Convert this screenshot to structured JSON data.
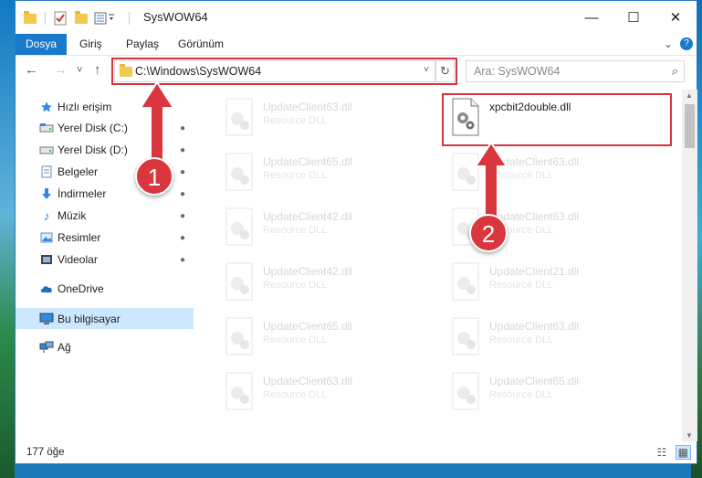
{
  "window": {
    "title": "SysWOW64",
    "minimize": "—",
    "maximize": "☐",
    "close": "✕"
  },
  "ribbon": {
    "tabs": [
      "Dosya",
      "Giriş",
      "Paylaş",
      "Görünüm"
    ],
    "expand": "⌄",
    "help": "?"
  },
  "address": {
    "back": "←",
    "forward": "→",
    "recent": "˅",
    "up": "↑",
    "path": "C:\\Windows\\SysWOW64",
    "dropdown": "˅",
    "refresh": "↻"
  },
  "search": {
    "placeholder": "Ara: SysWOW64",
    "icon": "⌕"
  },
  "sidebar": {
    "items": [
      {
        "label": "Hızlı erişim",
        "icon": "star-icon",
        "pinned": false
      },
      {
        "label": "Yerel Disk (C:)",
        "icon": "drive-icon",
        "pinned": true
      },
      {
        "label": "Yerel Disk (D:)",
        "icon": "drive-icon",
        "pinned": true
      },
      {
        "label": "Belgeler",
        "icon": "document-icon",
        "pinned": true
      },
      {
        "label": "İndirmeler",
        "icon": "download-icon",
        "pinned": true
      },
      {
        "label": "Müzik",
        "icon": "music-icon",
        "pinned": true
      },
      {
        "label": "Resimler",
        "icon": "pictures-icon",
        "pinned": true
      },
      {
        "label": "Videolar",
        "icon": "video-icon",
        "pinned": true
      },
      {
        "label": "OneDrive",
        "icon": "cloud-icon",
        "pinned": false
      },
      {
        "label": "Bu bilgisayar",
        "icon": "computer-icon",
        "pinned": false,
        "selected": true
      },
      {
        "label": "Ağ",
        "icon": "network-icon",
        "pinned": false
      }
    ],
    "pin_glyph": "📌"
  },
  "files": {
    "left_column": [
      {
        "name": "UpdateClient63.dll",
        "type": "Resource DLL"
      },
      {
        "name": "UpdateClient65.dll",
        "type": "Resource DLL"
      },
      {
        "name": "UpdateClient42.dll",
        "type": "Resource DLL"
      },
      {
        "name": "UpdateClient42.dll",
        "type": "Resource DLL"
      },
      {
        "name": "UpdateClient65.dll",
        "type": "Resource DLL"
      },
      {
        "name": "UpdateClient63.dll",
        "type": "Resource DLL"
      }
    ],
    "right_column": [
      {
        "name": "xpcbit2double.dll",
        "type": "",
        "highlighted": true
      },
      {
        "name": "UpdateClient63.dll",
        "type": "Resource DLL"
      },
      {
        "name": "UpdateClient63.dll",
        "type": "Resource DLL"
      },
      {
        "name": "UpdateClient21.dll",
        "type": "Resource DLL"
      },
      {
        "name": "UpdateClient63.dll",
        "type": "Resource DLL"
      },
      {
        "name": "UpdateClient65.dll",
        "type": "Resource DLL"
      }
    ]
  },
  "status": {
    "count": "177 öğe"
  },
  "annotations": {
    "step1": "1",
    "step2": "2",
    "color": "#d9363e"
  }
}
